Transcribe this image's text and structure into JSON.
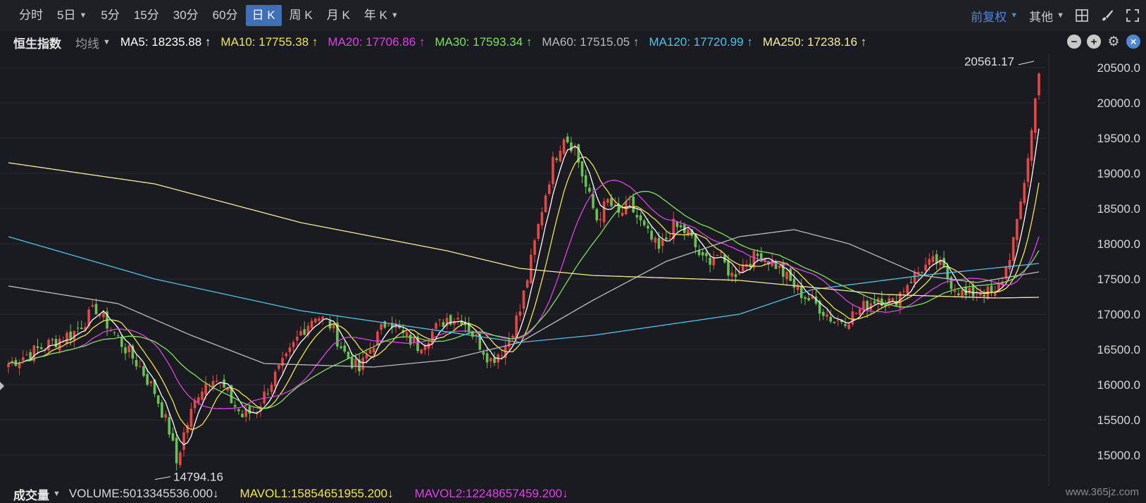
{
  "toolbar": {
    "tabs": [
      {
        "label": "分时"
      },
      {
        "label": "5日",
        "caret": true
      },
      {
        "label": "5分"
      },
      {
        "label": "15分"
      },
      {
        "label": "30分"
      },
      {
        "label": "60分"
      },
      {
        "label": "日 K",
        "active": true
      },
      {
        "label": "周 K"
      },
      {
        "label": "月 K"
      },
      {
        "label": "年 K",
        "caret": true
      }
    ],
    "adjust_label": "前复权",
    "other_label": "其他"
  },
  "legend": {
    "index_name": "恒生指数",
    "mode_label": "均线",
    "mas": [
      {
        "text": "MA5: 18235.88 ↑",
        "color": "#ffffff"
      },
      {
        "text": "MA10: 17755.38 ↑",
        "color": "#f0e64a"
      },
      {
        "text": "MA20: 17706.86 ↑",
        "color": "#e040e8"
      },
      {
        "text": "MA30: 17593.34 ↑",
        "color": "#7be35a"
      },
      {
        "text": "MA60: 17515.05 ↑",
        "color": "#b9b9b9"
      },
      {
        "text": "MA120: 17720.99 ↑",
        "color": "#4ec4e8"
      },
      {
        "text": "MA250: 17238.16 ↑",
        "color": "#f5ec9a"
      }
    ]
  },
  "colors": {
    "up": "#e84545",
    "down": "#67c452",
    "bg": "#1a1b20",
    "grid": "#2a2b31"
  },
  "bottom": {
    "vol_label": "成交量",
    "volume_text": "VOLUME:5013345536.000↓",
    "mavol1_text": "MAVOL1:15854651955.200↓",
    "mavol2_text": "MAVOL2:12248657459.200↓",
    "mavol1_color": "#f0e64a",
    "mavol2_color": "#e040e8"
  },
  "watermark": "www.365jz.com",
  "chart_data": {
    "type": "candlestick",
    "y_ticks": [
      "20500.0",
      "20000.0",
      "19500.0",
      "19000.0",
      "18500.0",
      "18000.0",
      "17500.0",
      "17000.0",
      "16500.0",
      "16000.0",
      "15500.0",
      "15000.0"
    ],
    "ylim": [
      14790,
      20610
    ],
    "annotations": {
      "max_text": "20561.17",
      "max_value": 20561.17,
      "min_text": "14794.16",
      "min_value": 14794.16
    },
    "price_path": [
      [
        0,
        16300
      ],
      [
        10,
        16550
      ],
      [
        18,
        16750
      ],
      [
        24,
        17080
      ],
      [
        30,
        16650
      ],
      [
        36,
        16250
      ],
      [
        40,
        15900
      ],
      [
        44,
        15350
      ],
      [
        46,
        14890
      ],
      [
        48,
        15300
      ],
      [
        52,
        15900
      ],
      [
        56,
        16150
      ],
      [
        60,
        15850
      ],
      [
        64,
        15550
      ],
      [
        68,
        15650
      ],
      [
        72,
        16050
      ],
      [
        76,
        16350
      ],
      [
        80,
        16750
      ],
      [
        84,
        17000
      ],
      [
        88,
        16850
      ],
      [
        92,
        16450
      ],
      [
        96,
        16200
      ],
      [
        100,
        16600
      ],
      [
        104,
        16950
      ],
      [
        108,
        16700
      ],
      [
        112,
        16550
      ],
      [
        116,
        16750
      ],
      [
        120,
        16950
      ],
      [
        124,
        16950
      ],
      [
        128,
        16650
      ],
      [
        132,
        16350
      ],
      [
        136,
        16550
      ],
      [
        140,
        17050
      ],
      [
        143,
        17750
      ],
      [
        146,
        18500
      ],
      [
        149,
        19150
      ],
      [
        152,
        19550
      ],
      [
        155,
        19350
      ],
      [
        158,
        18800
      ],
      [
        161,
        18350
      ],
      [
        164,
        18600
      ],
      [
        167,
        18400
      ],
      [
        170,
        18550
      ],
      [
        174,
        18200
      ],
      [
        178,
        17900
      ],
      [
        182,
        18250
      ],
      [
        186,
        18150
      ],
      [
        190,
        17750
      ],
      [
        194,
        17850
      ],
      [
        198,
        17550
      ],
      [
        202,
        17750
      ],
      [
        206,
        17850
      ],
      [
        210,
        17700
      ],
      [
        214,
        17450
      ],
      [
        218,
        17250
      ],
      [
        222,
        17100
      ],
      [
        226,
        16900
      ],
      [
        230,
        16950
      ],
      [
        234,
        17100
      ],
      [
        238,
        17250
      ],
      [
        242,
        17150
      ],
      [
        246,
        17450
      ],
      [
        250,
        17650
      ],
      [
        254,
        17750
      ],
      [
        258,
        17450
      ],
      [
        262,
        17250
      ],
      [
        266,
        17350
      ],
      [
        270,
        17250
      ],
      [
        273,
        17650
      ],
      [
        276,
        18250
      ],
      [
        278,
        18900
      ],
      [
        280,
        19600
      ],
      [
        282,
        20500
      ]
    ],
    "ma_series": [
      {
        "ref": "MA5",
        "color": "#ffffff",
        "period": 5
      },
      {
        "ref": "MA10",
        "color": "#f0e64a",
        "period": 10
      },
      {
        "ref": "MA20",
        "color": "#e040e8",
        "period": 20
      },
      {
        "ref": "MA30",
        "color": "#7be35a",
        "period": 30
      },
      {
        "ref": "MA60",
        "color": "#b9b9b9",
        "points": [
          [
            0,
            17400
          ],
          [
            30,
            17150
          ],
          [
            50,
            16700
          ],
          [
            70,
            16300
          ],
          [
            100,
            16250
          ],
          [
            120,
            16350
          ],
          [
            140,
            16600
          ],
          [
            160,
            17200
          ],
          [
            180,
            17750
          ],
          [
            200,
            18100
          ],
          [
            215,
            18200
          ],
          [
            230,
            18000
          ],
          [
            250,
            17550
          ],
          [
            265,
            17450
          ],
          [
            282,
            17600
          ]
        ]
      },
      {
        "ref": "MA120",
        "color": "#4ec4e8",
        "points": [
          [
            0,
            18100
          ],
          [
            40,
            17500
          ],
          [
            80,
            17050
          ],
          [
            120,
            16750
          ],
          [
            140,
            16600
          ],
          [
            160,
            16700
          ],
          [
            200,
            17000
          ],
          [
            220,
            17350
          ],
          [
            250,
            17550
          ],
          [
            282,
            17720
          ]
        ]
      },
      {
        "ref": "MA250",
        "color": "#f5ec9a",
        "points": [
          [
            0,
            19150
          ],
          [
            40,
            18850
          ],
          [
            80,
            18300
          ],
          [
            120,
            17900
          ],
          [
            140,
            17650
          ],
          [
            160,
            17550
          ],
          [
            200,
            17480
          ],
          [
            240,
            17280
          ],
          [
            270,
            17230
          ],
          [
            282,
            17240
          ]
        ]
      }
    ]
  }
}
